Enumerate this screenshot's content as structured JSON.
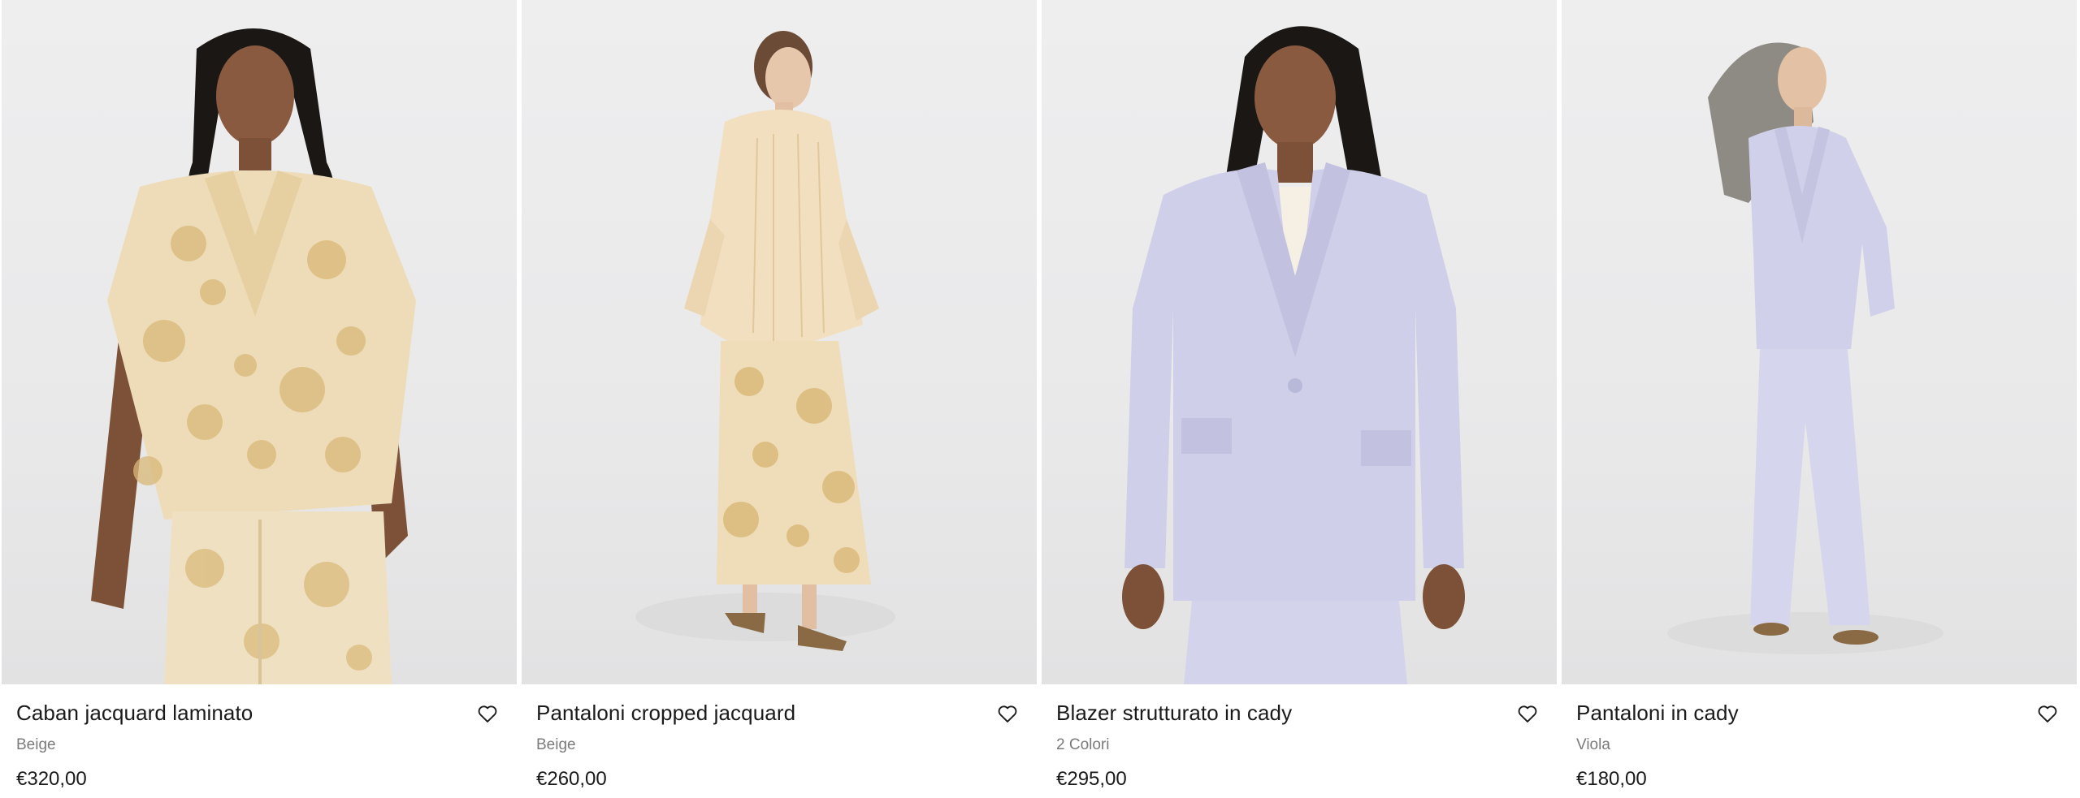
{
  "products": [
    {
      "name": "Caban jacquard laminato",
      "color": "Beige",
      "price": "€320,00",
      "image_alt": "Caban jacquard laminato"
    },
    {
      "name": "Pantaloni cropped jacquard",
      "color": "Beige",
      "price": "€260,00",
      "image_alt": "Pantaloni cropped jacquard"
    },
    {
      "name": "Blazer strutturato in cady",
      "color": "2 Colori",
      "price": "€295,00",
      "image_alt": "Blazer strutturato in cady"
    },
    {
      "name": "Pantaloni in cady",
      "color": "Viola",
      "price": "€180,00",
      "image_alt": "Pantaloni in cady"
    }
  ],
  "icons": {
    "wishlist": "heart-outline-icon"
  },
  "colors": {
    "beige": "#eedcb8",
    "beige_pattern": "#d9b878",
    "lilac": "#cfcfe9",
    "text": "#1a1a1a",
    "muted": "#7a7a7a"
  }
}
